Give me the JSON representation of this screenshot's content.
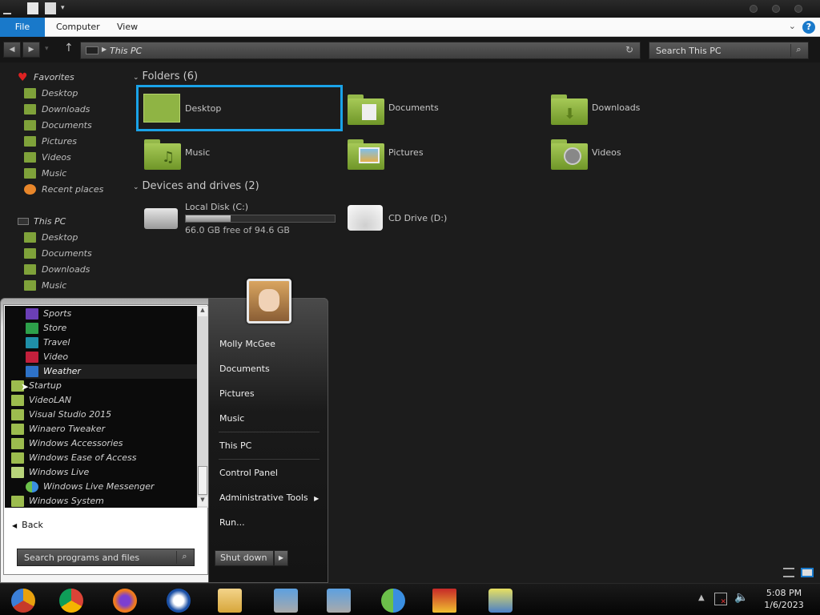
{
  "ribbon": {
    "file": "File",
    "computer": "Computer",
    "view": "View",
    "help": "?"
  },
  "address": {
    "path": "This PC",
    "search_placeholder": "Search This PC"
  },
  "nav": {
    "favorites": "Favorites",
    "favorites_items": [
      "Desktop",
      "Downloads",
      "Documents",
      "Pictures",
      "Videos",
      "Music",
      "Recent places"
    ],
    "thispc": "This PC",
    "thispc_items": [
      "Desktop",
      "Documents",
      "Downloads",
      "Music"
    ]
  },
  "content": {
    "folders_header": "Folders (6)",
    "folders": [
      "Desktop",
      "Documents",
      "Downloads",
      "Music",
      "Pictures",
      "Videos"
    ],
    "drives_header": "Devices and drives (2)",
    "drive_c": {
      "name": "Local Disk (C:)",
      "space": "66.0 GB free of 94.6 GB",
      "used_fraction": 0.3
    },
    "drive_d": {
      "name": "CD Drive (D:)"
    }
  },
  "start_menu": {
    "apps": [
      "Sports",
      "Store",
      "Travel",
      "Video",
      "Weather"
    ],
    "folders": [
      "Startup",
      "VideoLAN",
      "Visual Studio 2015",
      "Winaero Tweaker",
      "Windows Accessories",
      "Windows Ease of Access",
      "Windows Live"
    ],
    "live_messenger": "Windows Live Messenger",
    "windows_system": "Windows System",
    "back": "Back",
    "search_placeholder": "Search programs and files",
    "right_items": [
      "Molly McGee",
      "Documents",
      "Pictures",
      "Music",
      "This PC",
      "Control Panel",
      "Administrative Tools",
      "Run..."
    ],
    "shutdown": "Shut down"
  },
  "taskbar": {
    "time": "5:08 PM",
    "date": "1/6/2023",
    "apps": [
      "chrome-canary",
      "chrome",
      "firefox",
      "opera",
      "file-explorer",
      "setup-disc",
      "setup-disc-2",
      "windows-live-messenger",
      "winrar",
      "network-admin"
    ]
  },
  "colors": {
    "accent": "#1979ca",
    "selection_border": "#1aa3e8",
    "folder_green": "#8fb444"
  }
}
